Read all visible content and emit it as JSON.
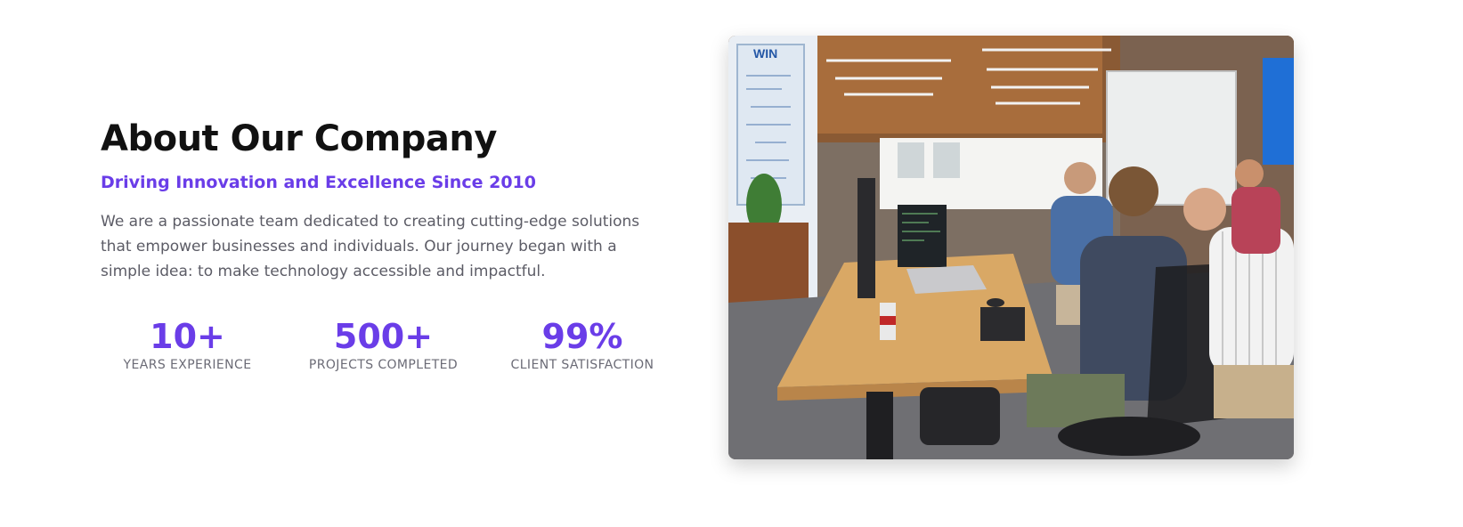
{
  "about": {
    "title": "About Our Company",
    "subtitle": "Driving Innovation and Excellence Since 2010",
    "description": "We are a passionate team dedicated to creating cutting-edge solutions that empower businesses and individuals. Our journey began with a simple idea: to make technology accessible and impactful."
  },
  "stats": [
    {
      "value": "10+",
      "label": "YEARS EXPERIENCE"
    },
    {
      "value": "500+",
      "label": "PROJECTS COMPLETED"
    },
    {
      "value": "99%",
      "label": "CLIENT SATISFACTION"
    }
  ],
  "image": {
    "wall_sign": "WIN"
  },
  "colors": {
    "accent": "#6a3de8",
    "heading": "#111111",
    "body_text": "#5c5c66",
    "stat_label": "#6b6b76"
  }
}
